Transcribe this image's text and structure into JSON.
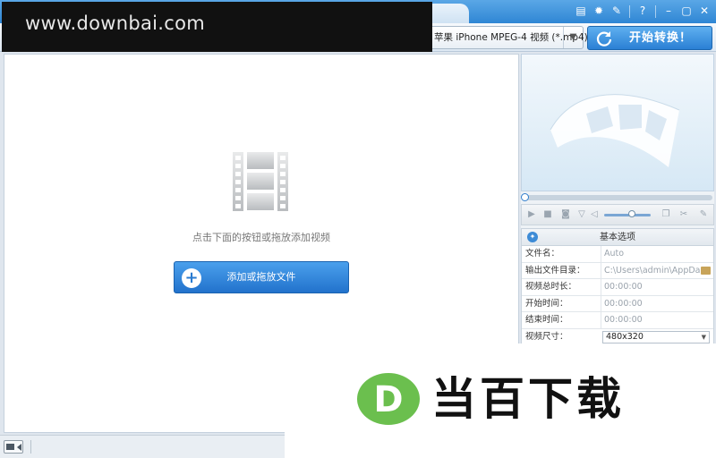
{
  "watermark": {
    "site_url": "www.downbai.com",
    "brand_text": "当百下载",
    "logo_letter": "D"
  },
  "window": {
    "controls": [
      "feedback-icon",
      "gear-icon",
      "wrench-icon",
      "help-icon",
      "minimize-icon",
      "restore-icon",
      "close-icon"
    ]
  },
  "toolbar": {
    "format_select_value": "苹果 iPhone MPEG-4 视频 (*.mp4)",
    "convert_label": "开始转换！"
  },
  "main": {
    "hint": "点击下面的按钮或拖放添加视频",
    "add_button_label": "添加或拖放文件"
  },
  "properties": {
    "header": "基本选项",
    "rows": [
      {
        "key": "文件名：",
        "value": "Auto"
      },
      {
        "key": "输出文件目录：",
        "value": "C:\\Users\\admin\\AppDa..."
      },
      {
        "key": "视频总时长：",
        "value": "00:00:00"
      },
      {
        "key": "开始时间：",
        "value": "00:00:00"
      },
      {
        "key": "结束时间：",
        "value": "00:00:00"
      },
      {
        "key": "视频尺寸：",
        "value": "480x320"
      }
    ]
  },
  "player": {
    "seek_position": 0,
    "volume_level": 0.6
  },
  "colors": {
    "accent": "#2f86d4",
    "brand_green": "#6bbf4e"
  }
}
